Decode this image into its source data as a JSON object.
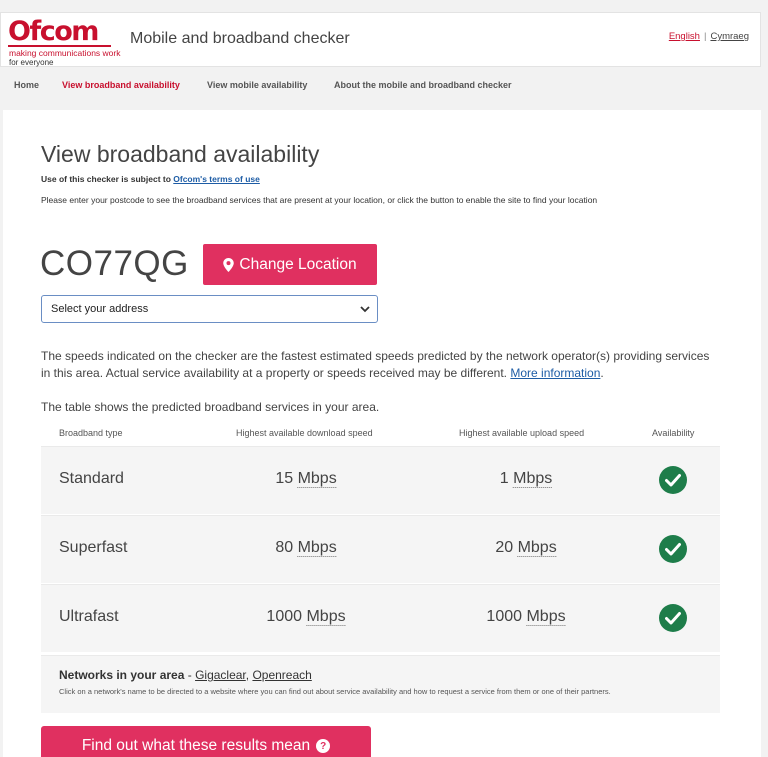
{
  "header": {
    "logo_text": "Ofcom",
    "logo_tagline_1": "making communications work",
    "logo_tagline_2": "for everyone",
    "site_title": "Mobile and broadband checker",
    "lang_english": "English",
    "lang_separator": "|",
    "lang_welsh": "Cymraeg"
  },
  "nav": {
    "items": [
      {
        "label": "Home"
      },
      {
        "label": "View broadband availability"
      },
      {
        "label": "View mobile availability"
      },
      {
        "label": "About the mobile and broadband checker"
      }
    ]
  },
  "page": {
    "title": "View broadband availability",
    "terms_prefix": "Use of this checker is subject to ",
    "terms_link": "Ofcom's terms of use",
    "instructions": "Please enter your postcode to see the broadband services that are present at your location, or click the button to enable the site to find your location",
    "postcode": "CO77QG",
    "change_location_label": "Change Location",
    "address_select": "Select your address",
    "disclaimer": "The speeds indicated on the checker are the fastest estimated speeds predicted by the network operator(s) providing services in this area. Actual service availability at a property or speeds received may be different. ",
    "more_info_link": "More information",
    "disclaimer_end": ".",
    "table_intro": "The table shows the predicted broadband services in your area."
  },
  "table": {
    "headers": [
      "Broadband type",
      "Highest available download speed",
      "Highest available upload speed",
      "Availability"
    ],
    "rows": [
      {
        "type": "Standard",
        "download": "15",
        "download_unit": "Mbps",
        "upload": "1",
        "upload_unit": "Mbps",
        "available": true
      },
      {
        "type": "Superfast",
        "download": "80",
        "download_unit": "Mbps",
        "upload": "20",
        "upload_unit": "Mbps",
        "available": true
      },
      {
        "type": "Ultrafast",
        "download": "1000",
        "download_unit": "Mbps",
        "upload": "1000",
        "upload_unit": "Mbps",
        "available": true
      }
    ]
  },
  "networks": {
    "label": "Networks in your area",
    "dash": " - ",
    "network_1": "Gigaclear",
    "comma": ", ",
    "network_2": "Openreach",
    "note": "Click on a network's name to be directed to a website where you can find out about service availability and how to request a service from them or one of their partners."
  },
  "results_button": {
    "label": "Find out what these results mean",
    "icon_glyph": "?"
  },
  "colors": {
    "brand": "#c8102e",
    "button": "#e03060",
    "tick": "#1e7d4a",
    "link": "#1d5ca5"
  },
  "icons": [
    "map-marker-icon",
    "chevron-down-icon",
    "check-circle-icon",
    "question-circle-icon"
  ]
}
